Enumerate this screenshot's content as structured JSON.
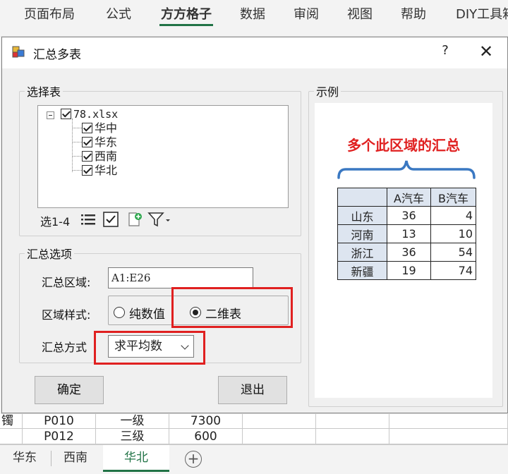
{
  "ribbon": {
    "tabs": [
      "页面布局",
      "公式",
      "方方格子",
      "数据",
      "审阅",
      "视图",
      "帮助",
      "DIY工具箱"
    ],
    "active_tab": "方方格子",
    "accent": "#217346"
  },
  "sheet": {
    "rows": [
      [
        "镯",
        "P010",
        "一级",
        "7300"
      ],
      [
        "",
        "P012",
        "三级",
        "600"
      ]
    ],
    "tabs": [
      "华东",
      "西南",
      "华北"
    ],
    "active_tab": "华北"
  },
  "dialog": {
    "title": "汇总多表",
    "help": "?",
    "close": "✕",
    "select_group": {
      "label": "选择表",
      "file": "78.xlsx",
      "sheets": [
        "华中",
        "华东",
        "西南",
        "华北"
      ],
      "toolbar_label": "选1-4"
    },
    "options_group": {
      "label": "汇总选项",
      "range_label": "汇总区域:",
      "range_value": "A1:E26",
      "style_label": "区域样式:",
      "style_options": [
        "纯数值",
        "二维表"
      ],
      "style_selected": "二维表",
      "method_label": "汇总方式",
      "method_value": "求平均数"
    },
    "ok_button": "确定",
    "exit_button": "退出",
    "example_group": {
      "label": "示例",
      "caption": "多个此区域的汇总",
      "columns": [
        "",
        "A汽车",
        "B汽车"
      ],
      "rows": [
        [
          "山东",
          "36",
          "4"
        ],
        [
          "河南",
          "13",
          "10"
        ],
        [
          "浙江",
          "36",
          "54"
        ],
        [
          "新疆",
          "19",
          "74"
        ]
      ]
    },
    "highlight_color": "#e02020"
  }
}
